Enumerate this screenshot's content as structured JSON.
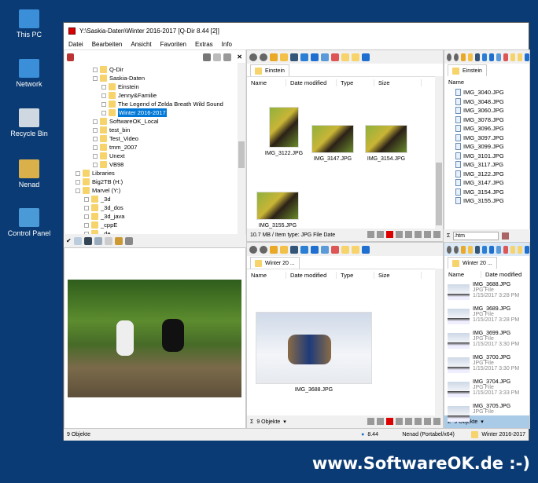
{
  "desktop": [
    "This PC",
    "Network",
    "Recycle Bin",
    "Nenad",
    "Control Panel"
  ],
  "window": {
    "title": "Y:\\Saskia-Daten\\Winter 2016-2017  [Q-Dir 8.44 [2]]"
  },
  "menu": [
    "Datei",
    "Bearbeiten",
    "Ansicht",
    "Favoriten",
    "Extras",
    "Info"
  ],
  "tree": [
    {
      "label": "Q-Dir",
      "level": 2
    },
    {
      "label": "Saskia-Daten",
      "level": 2
    },
    {
      "label": "Einstein",
      "level": 3
    },
    {
      "label": "Jenny&Familie",
      "level": 3
    },
    {
      "label": "The Legend of Zelda Breath Wild Sound",
      "level": 3
    },
    {
      "label": "Winter 2016-2017",
      "level": 3,
      "selected": true
    },
    {
      "label": "SoftwareOK_Local",
      "level": 2
    },
    {
      "label": "test_bin",
      "level": 2
    },
    {
      "label": "Test_Video",
      "level": 2
    },
    {
      "label": "tmm_2007",
      "level": 2
    },
    {
      "label": "Unext",
      "level": 2
    },
    {
      "label": "VB98",
      "level": 2
    },
    {
      "label": "Libraries",
      "level": 0
    },
    {
      "label": "Big2TB (H:)",
      "level": 0
    },
    {
      "label": "Marvel (Y:)",
      "level": 0
    },
    {
      "label": "_3d",
      "level": 1
    },
    {
      "label": "_3d_dos",
      "level": 1
    },
    {
      "label": "_3d_java",
      "level": 1
    },
    {
      "label": "_cppE",
      "level": 1
    },
    {
      "label": "_de",
      "level": 1
    }
  ],
  "columns": {
    "name": "Name",
    "date": "Date modified",
    "type": "Type",
    "size": "Size"
  },
  "pane1": {
    "tab": "Einstein",
    "thumbs": [
      "IMG_3122.JPG",
      "IMG_3147.JPG",
      "IMG_3154.JPG",
      "IMG_3155.JPG"
    ],
    "status": "10.7 MB / Item type: JPG File Date"
  },
  "pane2": {
    "tab": "Einstein",
    "files": [
      "IMG_3040.JPG",
      "IMG_3048.JPG",
      "IMG_3060.JPG",
      "IMG_3078.JPG",
      "IMG_3096.JPG",
      "IMG_3097.JPG",
      "IMG_3099.JPG",
      "IMG_3101.JPG",
      "IMG_3117.JPG",
      "IMG_3122.JPG",
      "IMG_3147.JPG",
      "IMG_3154.JPG",
      "IMG_3155.JPG"
    ],
    "filter": ".htm"
  },
  "pane3": {
    "tab": "Winter 20 ...",
    "thumb": "IMG_3688.JPG",
    "status": "9 Objekte"
  },
  "pane4": {
    "tab": "Winter 20 ...",
    "status": "9 Objekte",
    "items": [
      {
        "name": "IMG_3688.JPG",
        "type": "JPG File",
        "date": "1/15/2017 3:28 PM"
      },
      {
        "name": "IMG_3689.JPG",
        "type": "JPG File",
        "date": "1/15/2017 3:28 PM"
      },
      {
        "name": "IMG_3699.JPG",
        "type": "JPG File",
        "date": "1/15/2017 3:30 PM"
      },
      {
        "name": "IMG_3700.JPG",
        "type": "JPG File",
        "date": "1/15/2017 3:30 PM"
      },
      {
        "name": "IMG_3704.JPG",
        "type": "JPG File",
        "date": "1/15/2017 3:33 PM"
      },
      {
        "name": "IMG_3705.JPG",
        "type": "JPG File"
      }
    ]
  },
  "statusbar": {
    "left": "9 Objekte",
    "version": "8.44",
    "user": "Nenad (Portabel/x64)",
    "folder": "Winter 2016-2017"
  },
  "watermark": "www.SoftwareOK.de :-)"
}
